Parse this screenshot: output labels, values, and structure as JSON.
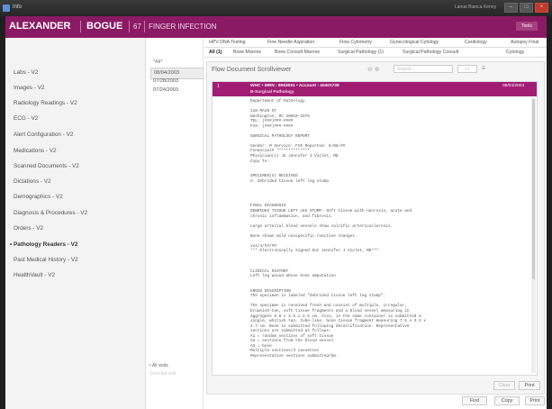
{
  "window": {
    "title": "Info",
    "user_account": "Lamat Bianca Kenny"
  },
  "patient": {
    "first_name": "ALEXANDER",
    "last_name": "BOGUE",
    "age": "67",
    "context": "FINGER INFECTION"
  },
  "tools_label": "Tools",
  "sidebar": {
    "items": [
      {
        "label": "Labs - V2"
      },
      {
        "label": "Images - V2"
      },
      {
        "label": "Radiology Readings - V2"
      },
      {
        "label": "ECG - V2"
      },
      {
        "label": "Alert Configuration - V2"
      },
      {
        "label": "Medications - V2"
      },
      {
        "label": "Scanned Documents - V2"
      },
      {
        "label": "Dictations - V2"
      },
      {
        "label": "Demographics - V2"
      },
      {
        "label": "Diagnosis & Procedures - V2"
      },
      {
        "label": "Orders - V2"
      },
      {
        "label": "Pathology Readers - V2"
      },
      {
        "label": "Past Medical History - V2"
      },
      {
        "label": "HealthVault - V2"
      }
    ],
    "active_index": 11
  },
  "dates": {
    "header": "*All*",
    "items": [
      "08/04/2003",
      "07/28/2003",
      "07/24/2003"
    ],
    "selected": 0,
    "all_visits": "All visits",
    "selected_visit": "Selected visit"
  },
  "tabs_row1": [
    "HPV DNA Testing",
    "Fine Needle Aspiration",
    "Flow Cytometry",
    "Gynecological Cytology",
    "Cardiology",
    "Autopsy Final"
  ],
  "tabs_row2": [
    "All (1)",
    "Bone Marrow",
    "Bone Consult Marrow",
    "Surgical Pathology (1)",
    "Surgical Pathology Consult",
    "Cytology"
  ],
  "viewer": {
    "title": "Flow Document Scrollviewer",
    "find_placeholder": "Search...",
    "zoom_icons": "⊖ ⊕",
    "nav": "‹ ›",
    "nav2": "☰"
  },
  "document": {
    "index": "1",
    "header": "WHC • MRN : 8063091 • Account : 40401739",
    "subheader": "B-Surgical Pathology",
    "date": "08/04/2003",
    "report": "Department of Pathology\n\n110 MAIN ST\nWashington, DC 20010-2975\nTEL: (###)###-####\nFAX: (###)###-####\n\nSURGICAL PATHOLOGY REPORT\n\nGender: M Service: FVS Reported: 8/08/##\nFinancial# **************\nPhysician(s) JG Jennifer J Violet, MD\nCopy To:\n\n\nSPECIMEN(S) RECEIVED\nA: debrided tissue left leg stump\n\n\n\n\nFINAL DIAGNOSIS\nDEBRIDED TISSUE LEFT LEG STUMP: Soft tissue with necrosis, acute and\nchronic inflammation, and fibrosis.\n\nLarge arterial blood vessels show calcific arteriosclerosis.\n\nBone shows mild nonspecific reactive changes.\n\nvos/4/##/##\n*** Electronically Signed Out Jennifer J Violet, MD***\n\n\n\nCLINICAL HISTORY\nLeft leg wound above knee amputation\n\n\nGROSS DESCRIPTION\nThe specimen is labeled \"debrided tissue left leg stump\".\n\nThe specimen is received fresh and consist of multiple, irregular,\nbrownish-tan, soft tissue fragments and a blood vessel measuring in\naggregate 6.0 x 3.5 x 2.5 cm. Also, in the same container is submitted a\nsingle, whitish tan, tube-like, bone tissue fragment measuring 7.5 x 3.5 x\n2.7 cm. Bone is submitted following decalcification. Representative\nsections are submitted as follows:\nA1 = random sections of soft tissue\nA2 = sections from the blood vessel\nA3 = bone\nMultiple sections/3 cassettes\nRepresentative sections submitted/bm."
  },
  "buttons": {
    "clear": "Clear",
    "print_inner": "Print",
    "find": "Find",
    "copy": "Copy",
    "print": "Print"
  },
  "colors": {
    "header": "#8b1a64",
    "doc_bar": "#a11d74"
  }
}
